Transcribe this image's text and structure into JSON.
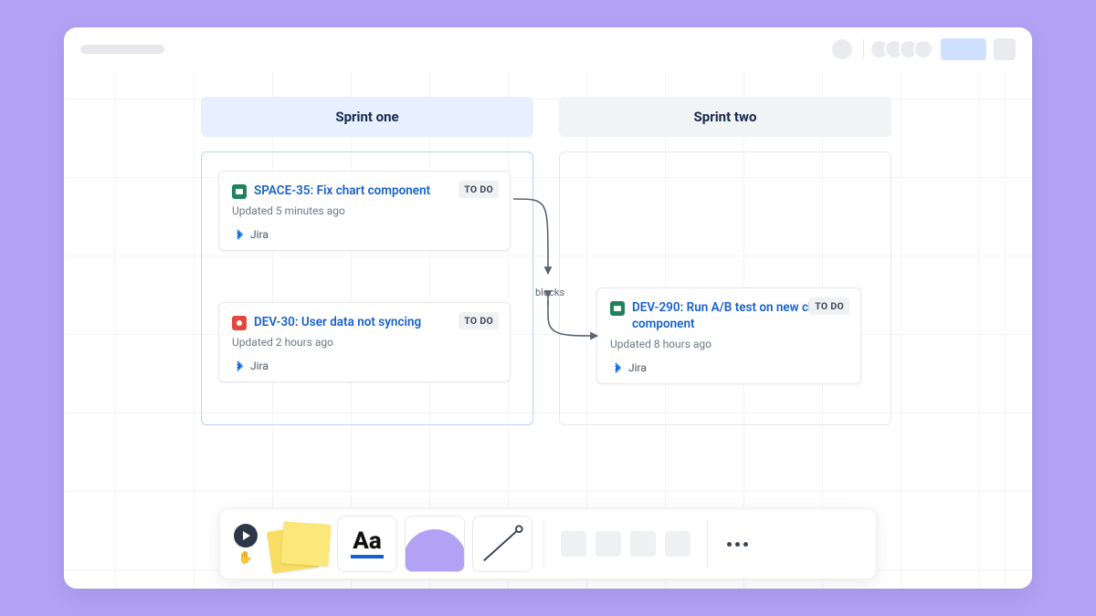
{
  "columns": [
    {
      "title": "Sprint one",
      "active": true
    },
    {
      "title": "Sprint two",
      "active": false
    }
  ],
  "cards": {
    "space35": {
      "title": "SPACE-35: Fix chart component",
      "status": "TO DO",
      "updated": "Updated 5 minutes ago",
      "source": "Jira",
      "type": "story"
    },
    "dev30": {
      "title": "DEV-30: User data not syncing",
      "status": "TO DO",
      "updated": "Updated 2 hours ago",
      "source": "Jira",
      "type": "bug"
    },
    "dev290": {
      "title": "DEV-290: Run A/B test on new chart component",
      "status": "TO DO",
      "updated": "Updated 8 hours ago",
      "source": "Jira",
      "type": "story"
    }
  },
  "relationship_label": "blocks",
  "toolbar": {
    "text_tool_label": "Aa"
  }
}
